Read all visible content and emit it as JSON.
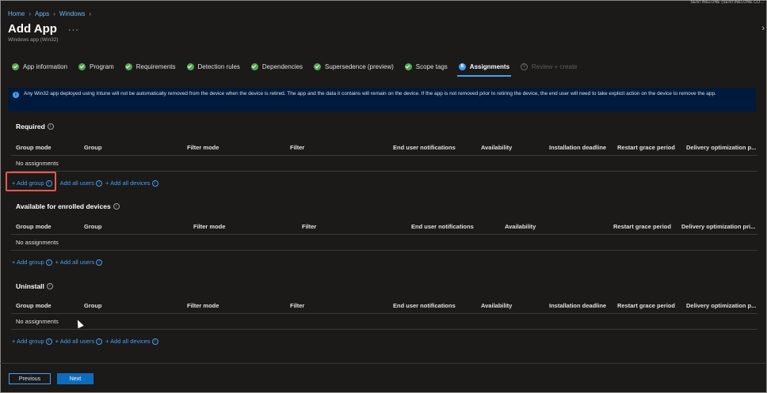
{
  "account": "SENTINELONE (SENTINELONE.CO...",
  "breadcrumb": [
    "Home",
    "Apps",
    "Windows"
  ],
  "title": "Add App",
  "subtitle": "Windows app (Win32)",
  "steps": {
    "app_information": "App information",
    "program": "Program",
    "requirements": "Requirements",
    "detection_rules": "Detection rules",
    "dependencies": "Dependencies",
    "supersedence": "Supersedence (preview)",
    "scope_tags": "Scope tags",
    "assignments": "Assignments",
    "assignments_num": "8",
    "review_create": "Review + create",
    "review_create_num": "9"
  },
  "info_text": "Any Win32 app deployed using Intune will not be automatically removed from the device when the device is retired. The app and the data it contains will remain on the device. If the app is not removed prior to retiring the device, the end user will need to take explicit action on the device to remove the app.",
  "sections": {
    "required": {
      "title": "Required",
      "columns": [
        "Group mode",
        "Group",
        "Filter mode",
        "Filter",
        "End user notifications",
        "Availability",
        "Installation deadline",
        "Restart grace period",
        "Delivery optimization p..."
      ],
      "empty": "No assignments",
      "actions": [
        "+ Add group",
        "Add all users",
        "+ Add all devices"
      ]
    },
    "available": {
      "title": "Available for enrolled devices",
      "columns": [
        "Group mode",
        "Group",
        "Filter mode",
        "Filter",
        "End user notifications",
        "Availability",
        "Restart grace period",
        "Delivery optimization pri..."
      ],
      "empty": "No assignments",
      "actions": [
        "+ Add group",
        "+ Add all users"
      ]
    },
    "uninstall": {
      "title": "Uninstall",
      "columns": [
        "Group mode",
        "Group",
        "Filter mode",
        "Filter",
        "End user notifications",
        "Availability",
        "Installation deadline",
        "Restart grace period",
        "Delivery optimization p..."
      ],
      "empty": "No assignments",
      "actions": [
        "+ Add group",
        "+ Add all users",
        "+ Add all devices"
      ]
    }
  },
  "buttons": {
    "previous": "Previous",
    "next": "Next"
  },
  "colors": {
    "accent": "#479ef5",
    "success": "#54a654",
    "highlight": "#e8594b",
    "background": "#1b1a19"
  }
}
